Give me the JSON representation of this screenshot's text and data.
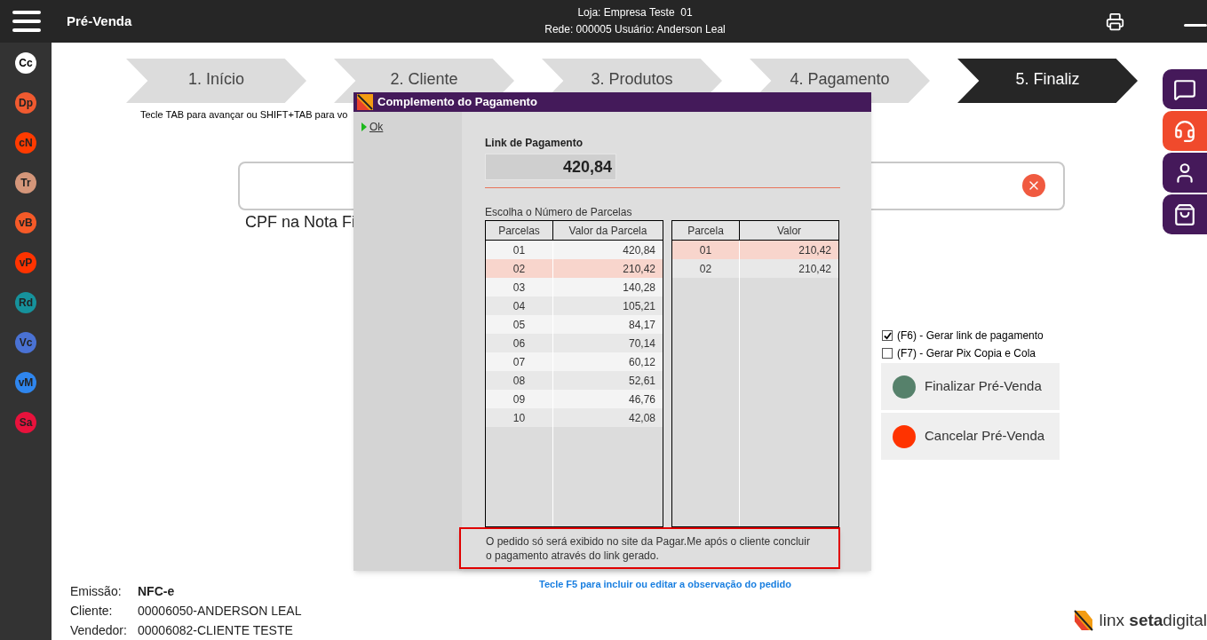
{
  "header": {
    "title": "Pré-Venda",
    "store": "Loja: Empresa Teste  01",
    "network_user": "Rede: 000005 Usuário: Anderson Leal"
  },
  "sidebar": {
    "items": [
      {
        "label": "Cc",
        "color": "#ffffff"
      },
      {
        "label": "Dp",
        "color": "#f05a30"
      },
      {
        "label": "cN",
        "color": "#ff3b00"
      },
      {
        "label": "Tr",
        "color": "#d4967a"
      },
      {
        "label": "vB",
        "color": "#f55a28"
      },
      {
        "label": "vP",
        "color": "#ff3300"
      },
      {
        "label": "Rd",
        "color": "#16929c"
      },
      {
        "label": "Vc",
        "color": "#4a72d4"
      },
      {
        "label": "vM",
        "color": "#2f86ee"
      },
      {
        "label": "Sa",
        "color": "#e8123c"
      }
    ]
  },
  "steps": [
    {
      "label": "1. Início",
      "selected": false
    },
    {
      "label": "2. Cliente",
      "selected": false
    },
    {
      "label": "3. Produtos",
      "selected": false
    },
    {
      "label": "4. Pagamento",
      "selected": false
    },
    {
      "label": "5. Finaliz",
      "selected": true
    }
  ],
  "hint": "Tecle TAB para avançar ou SHIFT+TAB para vo",
  "cpf_label": "CPF na Nota Fi",
  "right_tabs": [
    {
      "kind": "chat",
      "selected": false
    },
    {
      "kind": "support",
      "selected": true
    },
    {
      "kind": "user",
      "selected": false
    },
    {
      "kind": "bag",
      "selected": false
    }
  ],
  "options": [
    {
      "label": "(F6) - Gerar link de pagamento",
      "checked": true
    },
    {
      "label": "(F7) - Gerar Pix Copia e Cola",
      "checked": false
    }
  ],
  "actions": [
    {
      "label": "Finalizar Pré-Venda",
      "color": "#56816b"
    },
    {
      "label": "Cancelar Pré-Venda",
      "color": "#ff3300"
    }
  ],
  "observation_hint": "Tecle F5 para incluir ou editar a observação do pedido",
  "info": [
    {
      "label": "Emissão:",
      "value": "NFC-e",
      "bold": true
    },
    {
      "label": "Cliente:",
      "value": "00006050-ANDERSON LEAL",
      "bold": false
    },
    {
      "label": "Vendedor:",
      "value": "00006082-CLIENTE TESTE",
      "bold": false
    }
  ],
  "logo": "linx **seta**digital",
  "dialog": {
    "title": "Complemento do Pagamento",
    "ok": "Ok",
    "amount_label": "Link de Pagamento",
    "amount": "420,84",
    "choose_label": "Escolha o Número de Parcelas",
    "installments": {
      "columns": [
        "Parcelas",
        "Valor da Parcela"
      ],
      "rows": [
        {
          "n": "01",
          "value": "420,84",
          "selected": false
        },
        {
          "n": "02",
          "value": "210,42",
          "selected": true
        },
        {
          "n": "03",
          "value": "140,28",
          "selected": false
        },
        {
          "n": "04",
          "value": "105,21",
          "selected": false
        },
        {
          "n": "05",
          "value": "84,17",
          "selected": false
        },
        {
          "n": "06",
          "value": "70,14",
          "selected": false
        },
        {
          "n": "07",
          "value": "60,12",
          "selected": false
        },
        {
          "n": "08",
          "value": "52,61",
          "selected": false
        },
        {
          "n": "09",
          "value": "46,76",
          "selected": false
        },
        {
          "n": "10",
          "value": "42,08",
          "selected": false
        }
      ]
    },
    "schedule": {
      "columns": [
        "Parcela",
        "Valor"
      ],
      "rows": [
        {
          "n": "01",
          "value": "210,42",
          "selected": true
        },
        {
          "n": "02",
          "value": "210,42",
          "selected": false
        }
      ]
    },
    "notice": "O pedido só será exibido no site da Pagar.Me após o cliente concluir o pagamento através do link gerado."
  }
}
